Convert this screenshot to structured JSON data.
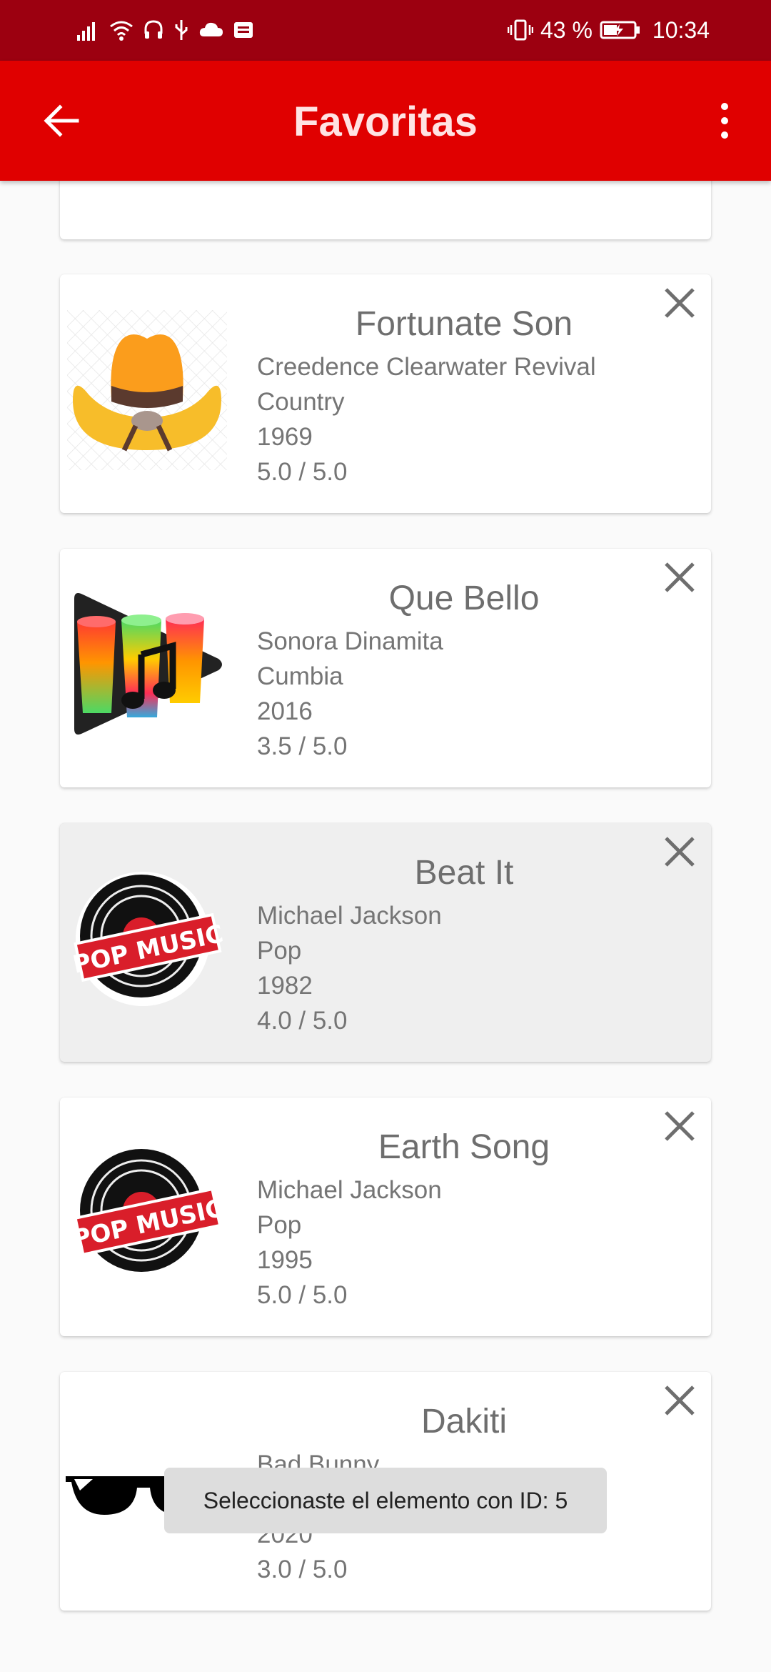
{
  "status_bar": {
    "battery": "43 %",
    "time": "10:34"
  },
  "app_bar": {
    "title": "Favoritas"
  },
  "songs": [
    {
      "title": "Fortunate Son",
      "artist": "Creedence Clearwater Revival",
      "genre": "Country",
      "year": "1969",
      "rating": "5.0 / 5.0",
      "image_icon": "cowboy-hat-icon"
    },
    {
      "title": "Que Bello",
      "artist": "Sonora Dinamita",
      "genre": "Cumbia",
      "year": "2016",
      "rating": "3.5 / 5.0",
      "image_icon": "cumbia-drums-icon"
    },
    {
      "title": "Beat It",
      "artist": "Michael Jackson",
      "genre": "Pop",
      "year": "1982",
      "rating": "4.0 / 5.0",
      "image_icon": "pop-music-badge-icon"
    },
    {
      "title": "Earth Song",
      "artist": "Michael Jackson",
      "genre": "Pop",
      "year": "1995",
      "rating": "5.0 / 5.0",
      "image_icon": "pop-music-badge-icon"
    },
    {
      "title": "Dakiti",
      "artist": "Bad Bunny",
      "genre": "",
      "year": "2020",
      "rating": "3.0 / 5.0",
      "image_icon": "sunglasses-icon"
    }
  ],
  "pop_badge_text": "POP MUSIC",
  "toast": {
    "message": "Seleccionaste el elemento con ID: 5"
  },
  "colors": {
    "status_bar": "#9c0010",
    "app_bar": "#e00000",
    "selected_card": "#efefef"
  }
}
